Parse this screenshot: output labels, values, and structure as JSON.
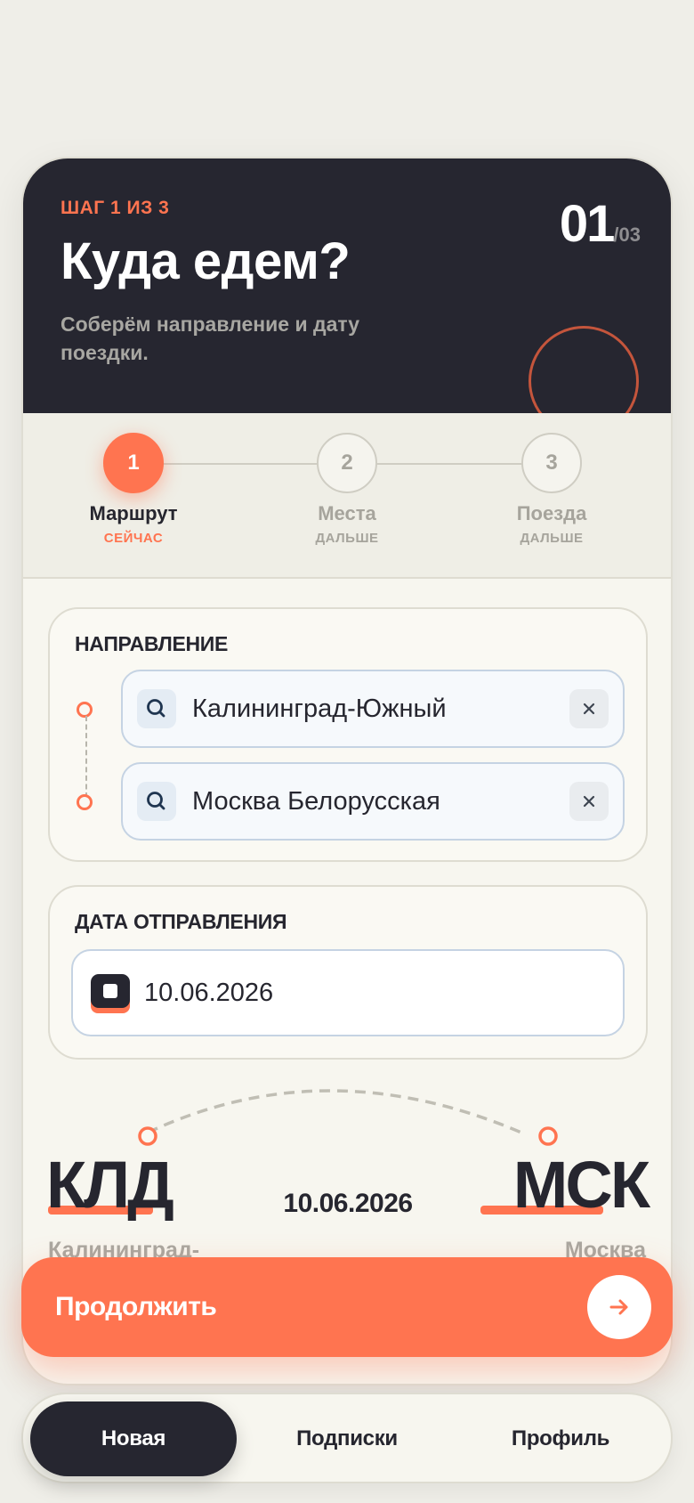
{
  "header": {
    "step_label": "ШАГ 1 ИЗ 3",
    "title": "Куда едем?",
    "subtitle": "Соберём направление и дату поездки.",
    "counter_current": "01",
    "counter_total": "/03"
  },
  "steps": [
    {
      "number": "1",
      "name": "Маршрут",
      "state": "СЕЙЧАС",
      "active": true
    },
    {
      "number": "2",
      "name": "Места",
      "state": "ДАЛЬШЕ",
      "active": false
    },
    {
      "number": "3",
      "name": "Поезда",
      "state": "ДАЛЬШЕ",
      "active": false
    }
  ],
  "direction": {
    "title": "НАПРАВЛЕНИЕ",
    "from_value": "Калининград-Южный",
    "to_value": "Москва Белорусская",
    "search_icon": "search-icon",
    "clear_icon": "close-icon"
  },
  "departure": {
    "title": "ДАТА ОТПРАВЛЕНИЯ",
    "date_value": "10.06.2026",
    "icon": "calendar-icon"
  },
  "summary": {
    "from_code": "КЛД",
    "to_code": "МСК",
    "date": "10.06.2026",
    "from_city": "Калининград-",
    "to_city": "Москва"
  },
  "continue_button": {
    "label": "Продолжить",
    "icon": "arrow-right-icon"
  },
  "tabbar": {
    "tabs": [
      {
        "label": "Новая",
        "active": true
      },
      {
        "label": "Подписки",
        "active": false
      },
      {
        "label": "Профиль",
        "active": false
      }
    ]
  },
  "colors": {
    "accent": "#ff7450",
    "dark": "#262630",
    "background": "#efeee8",
    "muted": "#a9a7a0"
  }
}
